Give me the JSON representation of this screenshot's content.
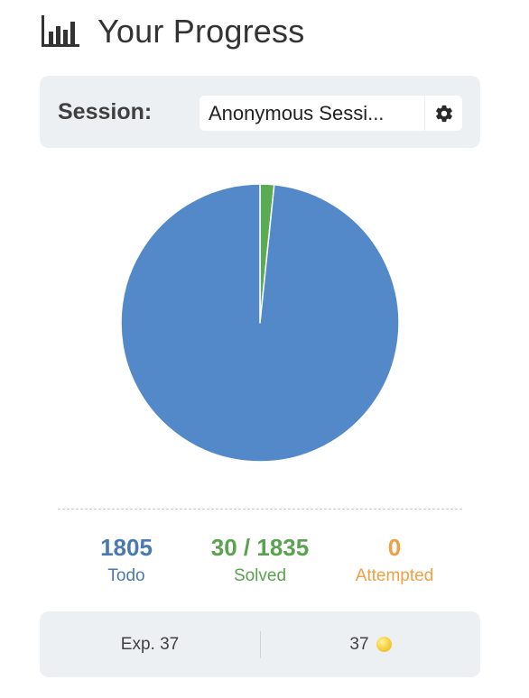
{
  "header": {
    "title": "Your Progress",
    "icon": "bar-chart-icon"
  },
  "session": {
    "label": "Session:",
    "value": "Anonymous Sessi...",
    "settings_icon": "gear-icon"
  },
  "chart_data": {
    "type": "pie",
    "categories": [
      "Todo",
      "Solved",
      "Attempted"
    ],
    "values": [
      1805,
      30,
      0
    ],
    "colors": [
      "#5389c8",
      "#5aab52",
      "#f0a043"
    ]
  },
  "stats": {
    "todo": {
      "value": "1805",
      "label": "Todo",
      "color": "#4a79b0"
    },
    "solved": {
      "value": "30 / 1835",
      "label": "Solved",
      "color": "#5aa24f"
    },
    "attempted": {
      "value": "0",
      "label": "Attempted",
      "color": "#f0a043"
    }
  },
  "footer": {
    "exp": "Exp. 37",
    "coins": "37",
    "coin_icon": "coin-icon"
  }
}
